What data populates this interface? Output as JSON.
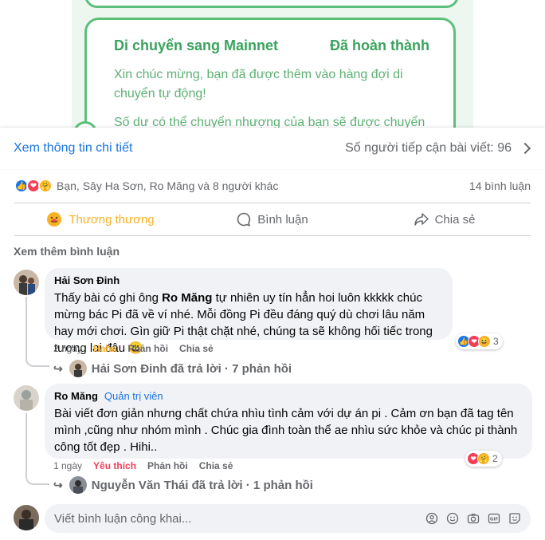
{
  "post_image": {
    "card_title": "Di chuyển sang Mainnet",
    "card_status": "Đã hoàn thành",
    "card_text_1": "Xin chúc mừng, bạn đã được thêm vào hàng đợi di chuyển tự động!",
    "card_text_2": "Số dư có thể chuyển nhượng của bạn sẽ được chuyển"
  },
  "details": {
    "link_label": "Xem thông tin chi tiết",
    "reach_label": "Số người tiếp cận bài viết: 96"
  },
  "reactions": {
    "names": "Bạn, Sây Ha Sơn, Ro Măng và 8 người khác",
    "comment_count": "14 bình luận"
  },
  "actions": {
    "react_label": "Thương thương",
    "comment_label": "Bình luận",
    "share_label": "Chia sẻ"
  },
  "more_comments": "Xem thêm bình luận",
  "comments": [
    {
      "author": "Hải Sơn Đinh",
      "text_before": "Thấy bài có ghi ông ",
      "mention": "Ro Măng",
      "text_after": " tự nhiên uy tín hẳn hoi luôn kkkkk chúc mừng bác Pi đã về ví nhé. Mỗi đồng Pi đều đáng quý dù chơi lâu năm hay mới chơi. Gìn giữ Pi thật chặt nhé, chúng ta sẽ không hối tiếc trong tương lai đâu",
      "emoji": "😀",
      "age": "2 ngày",
      "reaction": "Haha",
      "reply_action": "Phản hồi",
      "share_action": "Chia sẻ",
      "reaction_count": "3",
      "replies_summary": "Hải Sơn Đinh đã trả lời · 7 phản hồi"
    },
    {
      "author": "Ro Măng",
      "badge": "Quản trị viên",
      "text": "Bài viết đơn giản nhưng chất chứa nhìu tình cảm với dự án pi . Cảm ơn bạn đã tag tên mình ,cũng như nhóm mình . Chúc gia đình toàn thể ae nhìu sức khỏe và chúc pi thành công tốt đẹp . Hihi..",
      "age": "1 ngày",
      "reaction": "Yêu thích",
      "reply_action": "Phản hồi",
      "share_action": "Chia sẻ",
      "reaction_count": "2",
      "replies_summary": "Nguyễn Văn Thái đã trả lời · 1 phản hồi"
    }
  ],
  "composer": {
    "placeholder": "Viết bình luận công khai..."
  },
  "colors": {
    "link_blue": "#1b74e4",
    "mainnet_green": "#5cc07a",
    "care_yellow": "#f7b125",
    "love_red": "#f33e58"
  }
}
